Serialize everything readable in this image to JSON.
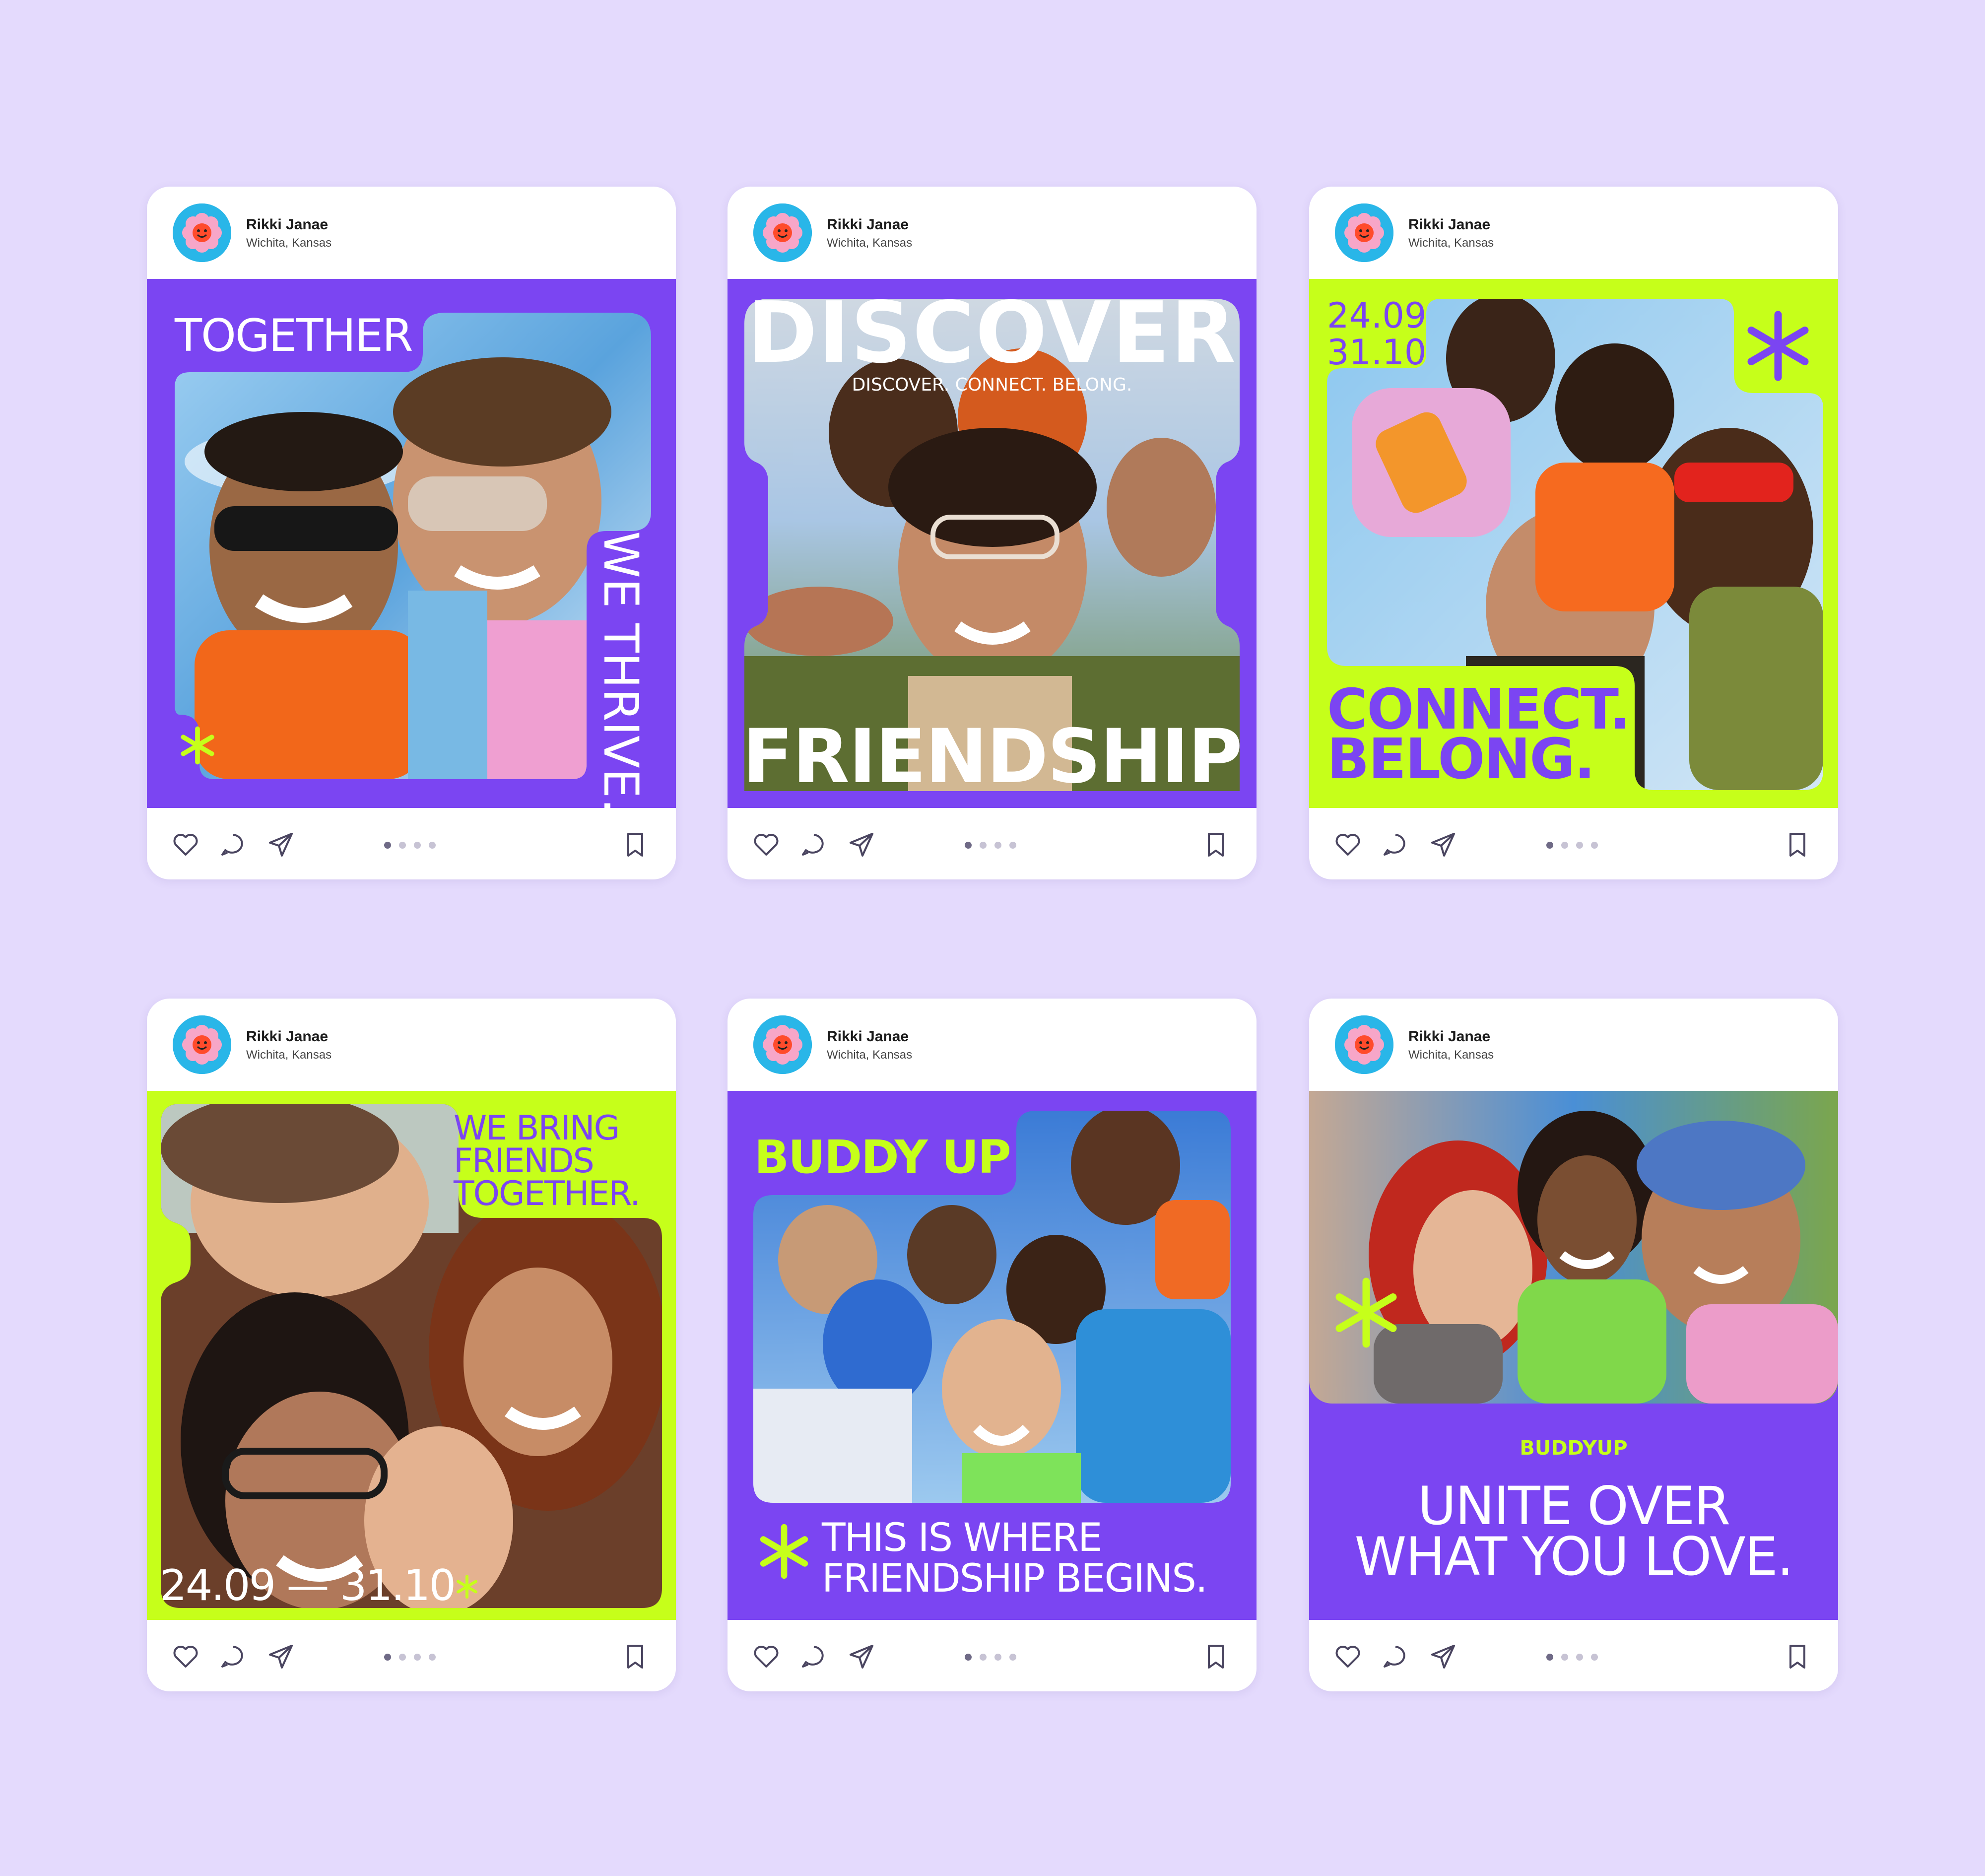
{
  "colors": {
    "background": "#e4dafd",
    "purple": "#7b45f2",
    "lime": "#c6ff1a",
    "white": "#ffffff"
  },
  "icons": {
    "avatar": "flower-smiley-icon",
    "like": "heart-icon",
    "comment": "speech-bubble-icon",
    "share": "paper-plane-icon",
    "save": "bookmark-icon",
    "accent": "asterisk-star-icon"
  },
  "carousel": {
    "total": 4,
    "current": 1
  },
  "posts": [
    {
      "user": {
        "name": "Rikki Janae",
        "location": "Wichita, Kansas"
      },
      "headline": "TOGETHER",
      "vertical": "WE THRIVE."
    },
    {
      "user": {
        "name": "Rikki Janae",
        "location": "Wichita, Kansas"
      },
      "headline": "DISCOVER",
      "tagline": "DISCOVER. CONNECT. BELONG.",
      "bottom": "FRIENDSHIP"
    },
    {
      "user": {
        "name": "Rikki Janae",
        "location": "Wichita, Kansas"
      },
      "date1": "24.09",
      "date2": "31.10",
      "line1": "CONNECT.",
      "line2": "BELONG."
    },
    {
      "user": {
        "name": "Rikki Janae",
        "location": "Wichita, Kansas"
      },
      "line1": "WE BRING",
      "line2": "FRIENDS",
      "line3": "TOGETHER.",
      "dates": "24.09 — 31.10"
    },
    {
      "user": {
        "name": "Rikki Janae",
        "location": "Wichita, Kansas"
      },
      "headline": "BUDDY UP",
      "line1": "THIS IS WHERE",
      "line2": "FRIENDSHIP BEGINS."
    },
    {
      "user": {
        "name": "Rikki Janae",
        "location": "Wichita, Kansas"
      },
      "brand": "BUDDYUP",
      "line1": "UNITE OVER",
      "line2": "WHAT YOU LOVE."
    }
  ]
}
